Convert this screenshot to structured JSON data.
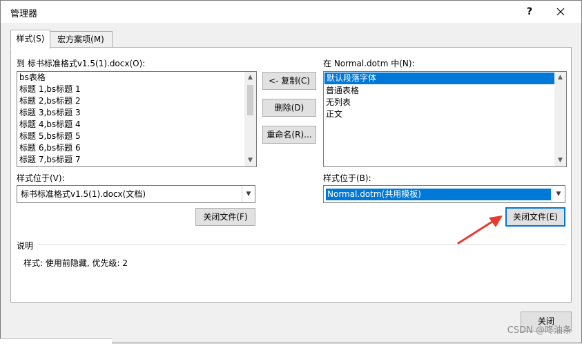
{
  "window": {
    "title": "管理器",
    "help_label": "?"
  },
  "tabs": [
    {
      "label": "样式(S)",
      "active": true
    },
    {
      "label": "宏方案项(M)",
      "active": false
    }
  ],
  "left": {
    "list_label": "到 标书标准格式v1.5(1).docx(O):",
    "items": [
      "bs表格",
      "标题 1,bs标题 1",
      "标题 2,bs标题 2",
      "标题 3,bs标题 3",
      "标题 4,bs标题 4",
      "标题 5,bs标题 5",
      "标题 6,bs标题 6",
      "标题 7,bs标题 7"
    ],
    "styles_in_label": "样式位于(V):",
    "styles_in_value": "标书标准格式v1.5(1).docx(文档)",
    "close_file_label": "关闭文件(F)"
  },
  "middle": {
    "copy_label": "<- 复制(C)",
    "delete_label": "删除(D)",
    "rename_label": "重命名(R)..."
  },
  "right": {
    "list_label": "在 Normal.dotm 中(N):",
    "items": [
      "默认段落字体",
      "普通表格",
      "无列表",
      "正文"
    ],
    "selected_index": 0,
    "styles_in_label": "样式位于(B):",
    "styles_in_value": "Normal.dotm(共用模板)",
    "close_file_label": "关闭文件(E)"
  },
  "description": {
    "header": "说明",
    "text": "样式: 使用前隐藏, 优先级: 2"
  },
  "footer": {
    "close_label": "关闭"
  },
  "annotation": {
    "arrow_color": "#e8392b"
  },
  "watermark": "CSDN @咚油条"
}
